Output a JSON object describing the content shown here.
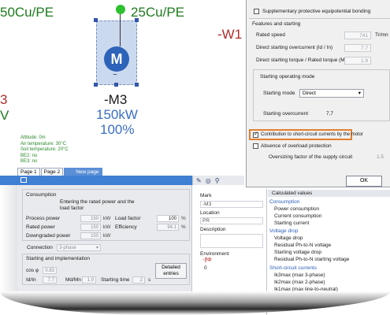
{
  "canvas": {
    "top_left_label": "50Cu/PE",
    "top_right_label": "25Cu/PE",
    "far_right_label": "-W1",
    "left_red_char": "3",
    "left_green_char": "V",
    "motor_letter": "M",
    "motor_tilde": "~",
    "motor_mark": "-M3",
    "motor_power": "150kW",
    "motor_load": "100%",
    "environment_lines": [
      "Altitude: 0m",
      "Air temperature: 30°C",
      "Soil temperature: 20°C",
      "BE2: no",
      "BE3: no"
    ]
  },
  "page_tabs": {
    "tab1": "Page 1",
    "tab2": "Page 2",
    "new_page": "New page"
  },
  "consumption": {
    "title": "Consumption",
    "hint": "Entering the rated power and the load factor",
    "process_power_label": "Process power",
    "process_power_value": "150",
    "rated_power_label": "Rated power",
    "rated_power_value": "150",
    "downgraded_power_label": "Downgraded power",
    "downgraded_power_value": "150",
    "unit_kw": "kW",
    "load_factor_label": "Load factor",
    "load_factor_value": "100",
    "efficiency_label": "Efficiency",
    "efficiency_value": "94.1",
    "unit_pct": "%",
    "connection_label": "Connection",
    "connection_value": "3-phase"
  },
  "starting": {
    "title": "Starting and implementation",
    "cos_label": "cos φ",
    "cos_value": "0.83",
    "id_in_label": "Id/In",
    "id_in_value": "7.7",
    "md_mn_label": "Md/Mn",
    "md_mn_value": "1.9",
    "starting_time_label": "Starting time",
    "starting_time_value": "2",
    "starting_time_unit": "s",
    "detailed_button": "Detailed entries"
  },
  "mark_panel": {
    "mark_label": "Mark",
    "mark_value": "-M3",
    "location_label": "Location",
    "location_value": "PR",
    "description_label": "Description",
    "environment_label": "Environment",
    "environment_value": "0"
  },
  "calculated": {
    "header": "Calculated values",
    "sections": [
      {
        "title": "Consumption",
        "items": [
          "Power consumption",
          "Current consumption",
          "Starting current"
        ]
      },
      {
        "title": "Voltage drop",
        "items": [
          "Voltage drop",
          "Residual Ph-to-N voltage",
          "Starting voltage drop",
          "Residual Ph-to-N starting voltage"
        ]
      },
      {
        "title": "Short-circuit currents",
        "items": [
          "Ik3max (max 3-phase)",
          "Ik2max (max 2-phase)",
          "Ik1max (max line-to-neutral)"
        ]
      }
    ]
  },
  "dialog": {
    "supp_bonding": "Supplementary protective equipotential bonding",
    "features_title": "Features and starting",
    "rated_speed_label": "Rated speed",
    "rated_speed_value": "741",
    "rated_speed_unit": "Tr/mn",
    "direct_overcurrent_label": "Direct starting overcurrent (Id / In)",
    "direct_overcurrent_value": "7.7",
    "direct_torque_label": "Direct starting torque / Rated torque (Md / Mn)",
    "direct_torque_value": "1.9",
    "starting_mode_title": "Starting operating mode",
    "starting_mode_label": "Starting mode",
    "starting_mode_value": "Direct",
    "starting_overcurrent_label": "Starting overcurrent",
    "starting_overcurrent_value": "7,7",
    "contribution_label": "Contribution to short-circuit currents by the motor",
    "absence_label": "Absence of overload protection",
    "oversizing_label": "Oversizing factor of the supply circuit",
    "oversizing_value": "1.5",
    "ok_label": "OK"
  },
  "colors": {
    "accent_blue": "#3f7fd4",
    "motor_blue": "#2d63b8",
    "highlight_orange": "#e08030",
    "label_green": "#1f7a1f",
    "label_red": "#b22a2a"
  }
}
